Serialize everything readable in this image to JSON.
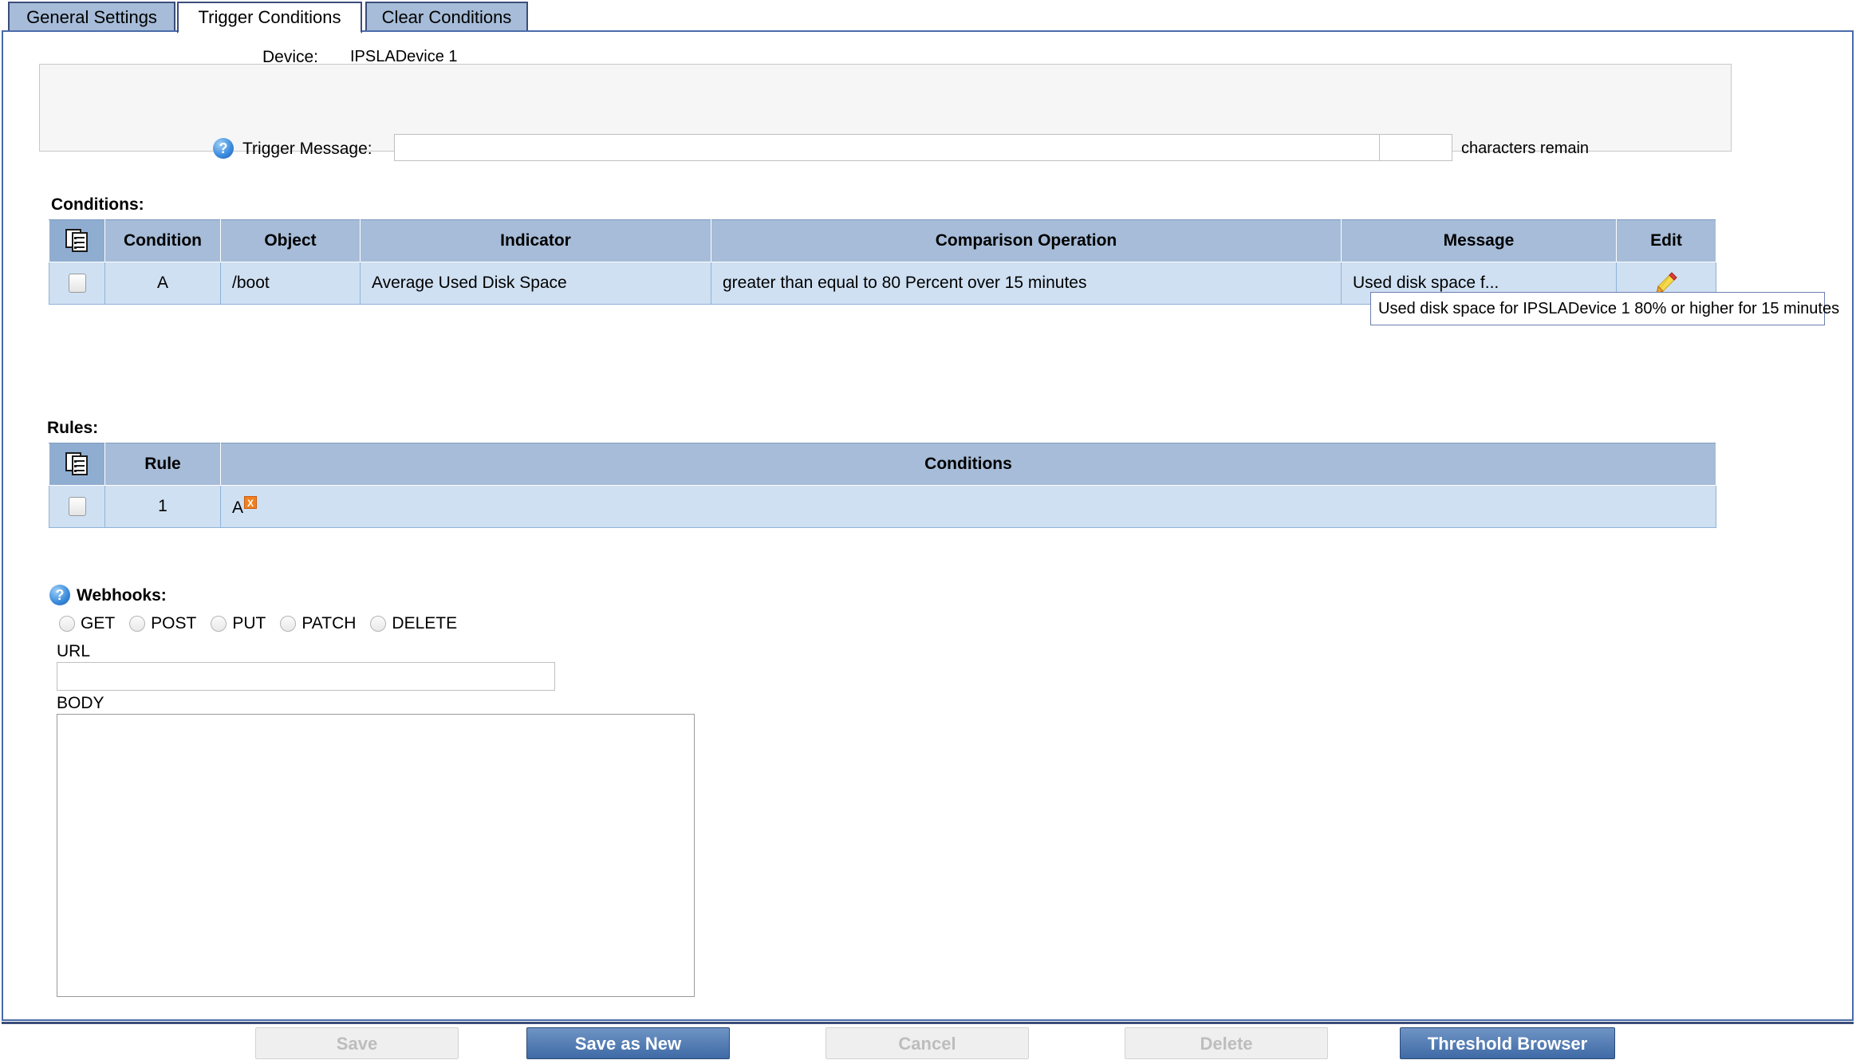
{
  "tabs": [
    {
      "label": "General Settings",
      "active": false
    },
    {
      "label": "Trigger Conditions",
      "active": true
    },
    {
      "label": "Clear Conditions",
      "active": false
    }
  ],
  "device": {
    "label": "Device:",
    "value": "IPSLADevice 1"
  },
  "trigger_message": {
    "label": "Trigger Message:",
    "value": "",
    "placeholder": "",
    "char_count_value": "",
    "char_count_label": "characters remain",
    "help_icon": "help-icon"
  },
  "conditions": {
    "title": "Conditions:",
    "columns": [
      "",
      "Condition",
      "Object",
      "Indicator",
      "Comparison Operation",
      "Message",
      "Edit"
    ],
    "rows": [
      {
        "condition": "A",
        "object": "/boot",
        "indicator": "Average  Used Disk Space",
        "comparison": "greater than equal to 80 Percent over 15 minutes",
        "message": "Used disk space f...",
        "edit_icon": "pencil-icon"
      }
    ],
    "tooltip": "Used disk space for IPSLADevice 1 80% or higher for 15 minutes"
  },
  "rules": {
    "title": "Rules:",
    "columns": [
      "",
      "Rule",
      "Conditions"
    ],
    "rows": [
      {
        "rule": "1",
        "conditions": "A",
        "remove_badge": "X"
      }
    ]
  },
  "webhooks": {
    "title": "Webhooks:",
    "methods": [
      "GET",
      "POST",
      "PUT",
      "PATCH",
      "DELETE"
    ],
    "selected_method": "",
    "url_label": "URL",
    "url_value": "",
    "body_label": "BODY",
    "body_value": ""
  },
  "footer": {
    "save": "Save",
    "save_as_new": "Save as New",
    "cancel": "Cancel",
    "delete": "Delete",
    "threshold_browser": "Threshold Browser"
  },
  "colors": {
    "tab_inactive": "#a6bcd8",
    "tab_border": "#3b4d7a",
    "panel_border": "#4a6baa",
    "table_header": "#a6bcd8",
    "table_row": "#cfe0f2",
    "primary_button": "#3f6aa6",
    "badge_orange": "#f08020"
  }
}
